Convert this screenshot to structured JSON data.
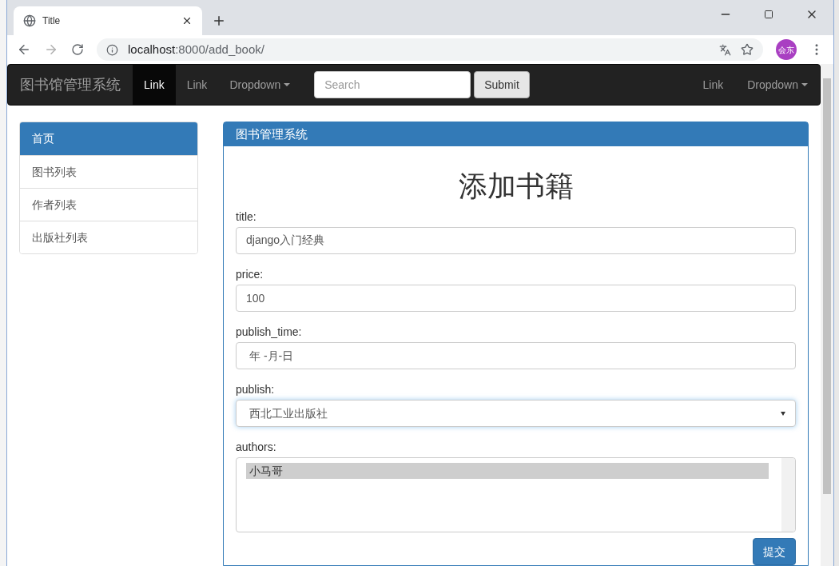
{
  "browser": {
    "tab_title": "Title",
    "url_host": "localhost",
    "url_rest": ":8000/add_book/",
    "profile": "会东"
  },
  "navbar": {
    "brand": "图书馆管理系统",
    "left_items": [
      {
        "label": "Link",
        "selected": true,
        "kind": "link"
      },
      {
        "label": "Link",
        "selected": false,
        "kind": "link"
      },
      {
        "label": "Dropdown",
        "selected": false,
        "kind": "dropdown"
      }
    ],
    "search": {
      "placeholder": "Search"
    },
    "submit": "Submit",
    "right_items": [
      {
        "label": "Link",
        "kind": "link"
      },
      {
        "label": "Dropdown",
        "kind": "dropdown"
      }
    ]
  },
  "sidebar": {
    "items": [
      {
        "label": "首页",
        "selected": true
      },
      {
        "label": "图书列表",
        "selected": false
      },
      {
        "label": "作者列表",
        "selected": false
      },
      {
        "label": "出版社列表",
        "selected": false
      }
    ]
  },
  "panel": {
    "title": "图书管理系统",
    "heading": "添加书籍",
    "fields": [
      {
        "label": "title:",
        "kind": "text",
        "value": "django入门经典"
      },
      {
        "label": "price:",
        "kind": "text",
        "value": "100"
      },
      {
        "label": "publish_time:",
        "kind": "date",
        "value": "年 -月-日"
      },
      {
        "label": "publish:",
        "kind": "select",
        "value": "西北工业出版社"
      },
      {
        "label": "authors:",
        "kind": "multiselect",
        "options": [
          {
            "label": "小马哥",
            "selected": true
          }
        ]
      }
    ],
    "submit": "提交"
  }
}
